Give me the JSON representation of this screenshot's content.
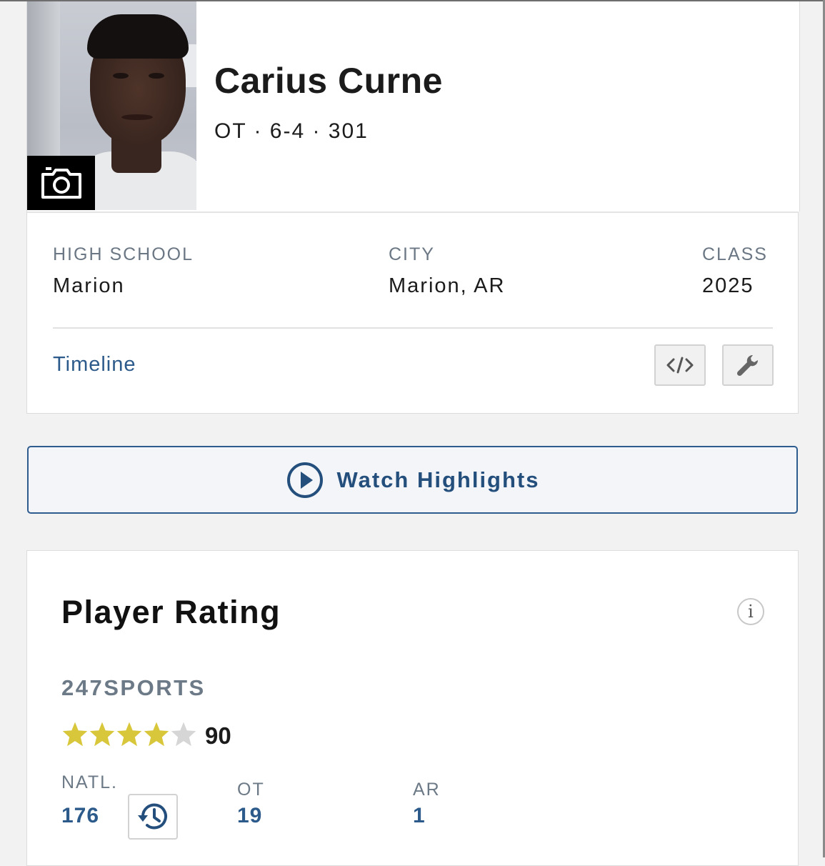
{
  "player": {
    "name": "Carius Curne",
    "meta": "OT · 6-4 · 301"
  },
  "info": {
    "high_school_label": "HIGH SCHOOL",
    "high_school_value": "Marion",
    "city_label": "CITY",
    "city_value": "Marion, AR",
    "class_label": "CLASS",
    "class_value": "2025",
    "timeline_label": "Timeline",
    "embed_icon": "code-icon",
    "tools_icon": "wrench-icon"
  },
  "highlights": {
    "label": "Watch Highlights",
    "icon": "play-circle-icon"
  },
  "rating": {
    "title": "Player Rating",
    "info_icon_text": "i",
    "source": "247SPORTS",
    "stars": 4,
    "stars_max": 5,
    "score": "90",
    "ranks": {
      "natl_label": "NATL.",
      "natl_value": "176",
      "position_label": "OT",
      "position_value": "19",
      "state_label": "AR",
      "state_value": "1"
    },
    "history_icon": "history-icon"
  },
  "colors": {
    "link_blue": "#2c5a8a",
    "star_gold": "#d9c73b",
    "star_empty": "#d6d6d6",
    "label_gray": "#6b7784"
  }
}
